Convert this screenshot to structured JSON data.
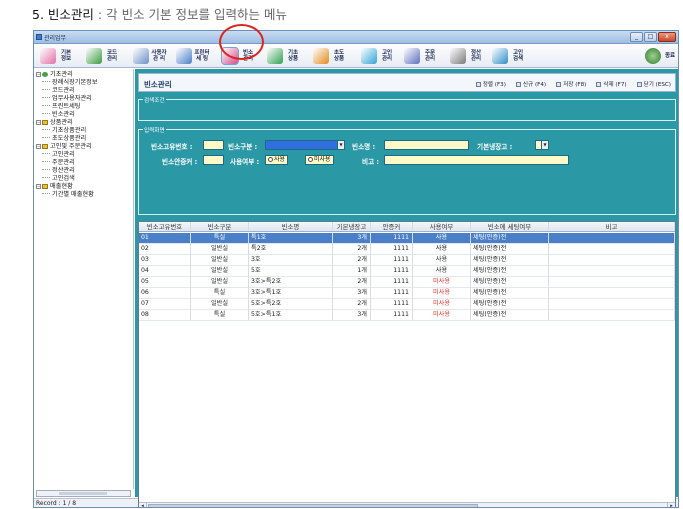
{
  "page_heading": {
    "number": "5.",
    "title": "빈소관리",
    "sep": " : ",
    "desc": "각 빈소 기본 정보를 입력하는 메뉴"
  },
  "window": {
    "title": "관리업무",
    "minimize": "_",
    "maximize": "□",
    "close": "x"
  },
  "toolbar": {
    "items": [
      {
        "label": "기본\n정보",
        "color": "#e36fa6"
      },
      {
        "label": "코드\n관리",
        "color": "#3a9b3f"
      },
      {
        "label": "사용자\n관 리",
        "color": "#6c8fc6"
      },
      {
        "label": "프린터\n세 팅",
        "color": "#4a7ec9"
      },
      {
        "label": "빈소\n관리",
        "color": "#d14b8b"
      },
      {
        "label": "기초\n상품",
        "color": "#2fa04d"
      },
      {
        "label": "초도\n상품",
        "color": "#e28b1e"
      },
      {
        "label": "고인\n관리",
        "color": "#2ea3d6"
      },
      {
        "label": "주문\n관리",
        "color": "#5b6fbf"
      },
      {
        "label": "정산\n관리",
        "color": "#7a7a7a"
      },
      {
        "label": "고인\n검색",
        "color": "#2e8ec9"
      }
    ],
    "exit_label": "종료"
  },
  "tree": {
    "groups": [
      {
        "label": "기초관리",
        "items": [
          "장례식장기본정보",
          "코드관리",
          "업무사용자관리",
          "프린트세팅",
          "빈소관리"
        ]
      },
      {
        "label": "상품관리",
        "items": [
          "기초상품관리",
          "초도상품관리"
        ]
      },
      {
        "label": "고인및 주문관리",
        "items": [
          "고인관리",
          "주문관리",
          "정산관리",
          "고인검색"
        ]
      },
      {
        "label": "매출현황",
        "items": [
          "기간별 매출현황"
        ]
      }
    ]
  },
  "statusbar": {
    "text": "Record : 1 / 8"
  },
  "content": {
    "title": "빈소관리",
    "actions": [
      {
        "label": "정렬 (F3)"
      },
      {
        "label": "신규 (F4)"
      },
      {
        "label": "저장 (F8)"
      },
      {
        "label": "삭제 (F7)"
      },
      {
        "label": "닫기 (ESC)"
      }
    ],
    "search_legend": "검색조건",
    "input_legend": "입력화면",
    "form": {
      "code_label": "빈소고유번호 :",
      "type_label": "빈소구분 :",
      "name_label": "빈소명 :",
      "fridge_label": "기본냉장고 :",
      "cremation_label": "빈소안증커 :",
      "use_label": "사용여부 :",
      "use_yes": "사용",
      "use_no": "미사용",
      "note_label": "비고 :"
    }
  },
  "grid": {
    "headers": [
      "빈소고유번호",
      "빈소구분",
      "빈소명",
      "기본냉장고",
      "안증커",
      "사용여부",
      "빈소에 세팅여부",
      "비고"
    ],
    "rows": [
      {
        "code": "01",
        "type": "특실",
        "name": "특1호",
        "fridge": "3개",
        "ash": "1111",
        "use": "사용",
        "setting": "세팅(안증)전",
        "note": ""
      },
      {
        "code": "02",
        "type": "일반실",
        "name": "특2호",
        "fridge": "2개",
        "ash": "1111",
        "use": "사용",
        "setting": "세팅(안증)전",
        "note": ""
      },
      {
        "code": "03",
        "type": "일반실",
        "name": "3호",
        "fridge": "2개",
        "ash": "1111",
        "use": "사용",
        "setting": "세팅(안증)전",
        "note": ""
      },
      {
        "code": "04",
        "type": "일반실",
        "name": "5호",
        "fridge": "1개",
        "ash": "1111",
        "use": "사용",
        "setting": "세팅(안증)전",
        "note": ""
      },
      {
        "code": "05",
        "type": "일반실",
        "name": "3호>특2호",
        "fridge": "2개",
        "ash": "1111",
        "use": "미사용",
        "setting": "세팅(안증)전",
        "note": ""
      },
      {
        "code": "06",
        "type": "특실",
        "name": "3호>특1호",
        "fridge": "3개",
        "ash": "1111",
        "use": "미사용",
        "setting": "세팅(안증)전",
        "note": ""
      },
      {
        "code": "07",
        "type": "일반실",
        "name": "5호>특2호",
        "fridge": "2개",
        "ash": "1111",
        "use": "미사용",
        "setting": "세팅(안증)전",
        "note": ""
      },
      {
        "code": "08",
        "type": "특실",
        "name": "5호>특1호",
        "fridge": "3개",
        "ash": "1111",
        "use": "미사용",
        "setting": "세팅(안증)전",
        "note": ""
      }
    ],
    "selected_index": 0,
    "red_value": "미사용",
    "accent_red": "#e0322a",
    "scroll_left": "◂",
    "scroll_right": "▸"
  },
  "annotation": {
    "highlight": "빈소관리 toolbar button",
    "color": "#d9261c"
  }
}
